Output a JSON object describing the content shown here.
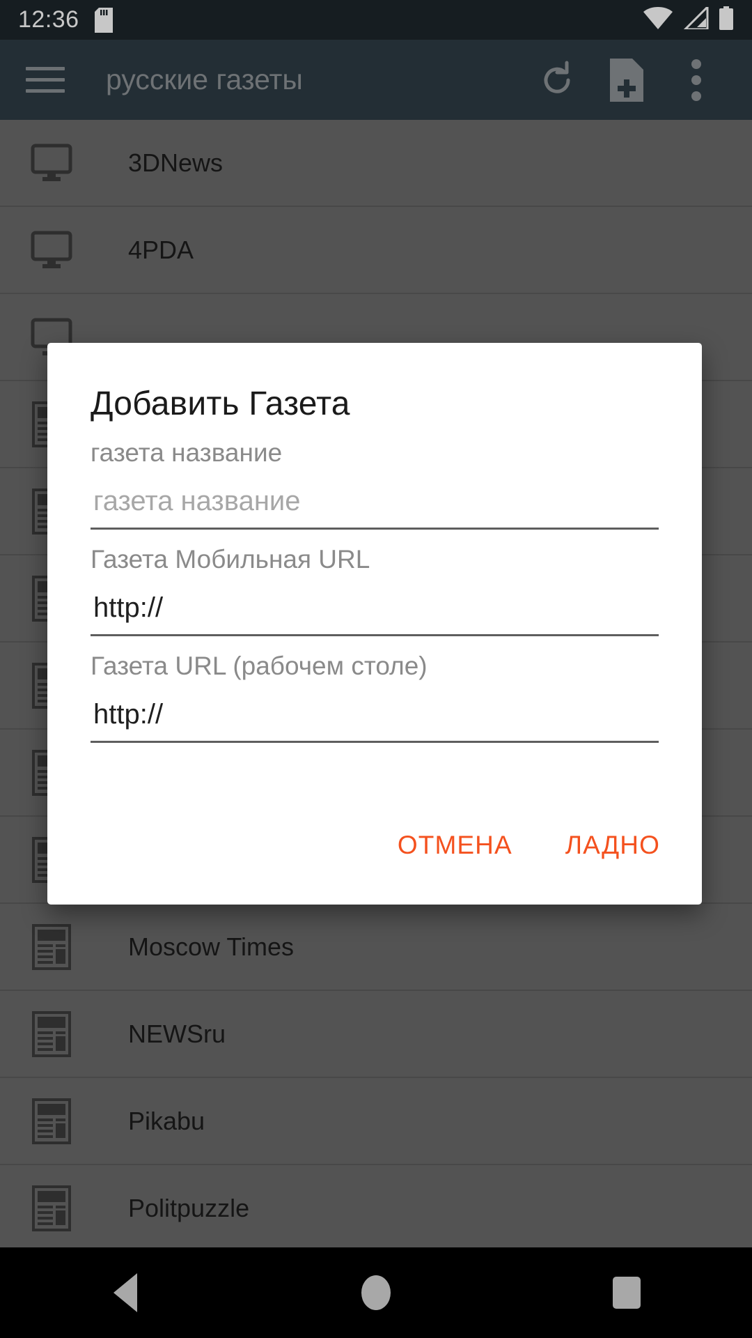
{
  "status_bar": {
    "clock": "12:36",
    "icons": [
      "sd-card-icon",
      "wifi-icon",
      "cellular-signal-icon",
      "battery-icon"
    ]
  },
  "app_bar": {
    "menu_icon": "hamburger-menu-icon",
    "title": "русские газеты",
    "actions": [
      {
        "icon": "refresh-icon"
      },
      {
        "icon": "add-file-icon"
      },
      {
        "icon": "overflow-menu-icon"
      }
    ]
  },
  "list": {
    "rows": [
      {
        "icon": "monitor-icon",
        "label": "3DNews"
      },
      {
        "icon": "monitor-icon",
        "label": "4PDA"
      },
      {
        "icon": "monitor-icon",
        "label": ""
      },
      {
        "icon": "newspaper-icon",
        "label": ""
      },
      {
        "icon": "newspaper-icon",
        "label": ""
      },
      {
        "icon": "newspaper-icon",
        "label": ""
      },
      {
        "icon": "newspaper-icon",
        "label": ""
      },
      {
        "icon": "newspaper-icon",
        "label": ""
      },
      {
        "icon": "newspaper-icon",
        "label": ""
      },
      {
        "icon": "newspaper-icon",
        "label": "Moscow Times"
      },
      {
        "icon": "newspaper-icon",
        "label": "NEWSru"
      },
      {
        "icon": "newspaper-icon",
        "label": "Pikabu"
      },
      {
        "icon": "newspaper-icon",
        "label": "Politpuzzle"
      }
    ]
  },
  "dialog": {
    "title": "Добавить Газета",
    "fields": [
      {
        "label": "газета название",
        "value": "",
        "placeholder": "газета название"
      },
      {
        "label": "Газета Мобильная URL",
        "value": "http://",
        "placeholder": "http://"
      },
      {
        "label": "Газета URL (рабочем столе)",
        "value": "http://",
        "placeholder": "http://"
      }
    ],
    "cancel_label": "ОТМЕНА",
    "ok_label": "ЛАДНО",
    "accent_color": "#f4511e"
  },
  "nav_bar": {
    "back": "back-nav-icon",
    "home": "home-nav-icon",
    "recents": "recents-nav-icon"
  },
  "colors": {
    "status_bar_bg": "#1d262b",
    "app_bar_bg": "#2d3b44",
    "list_bg": "#6b6b6b",
    "dialog_bg": "#ffffff",
    "accent": "#f4511e",
    "nav_bg": "#000000"
  }
}
